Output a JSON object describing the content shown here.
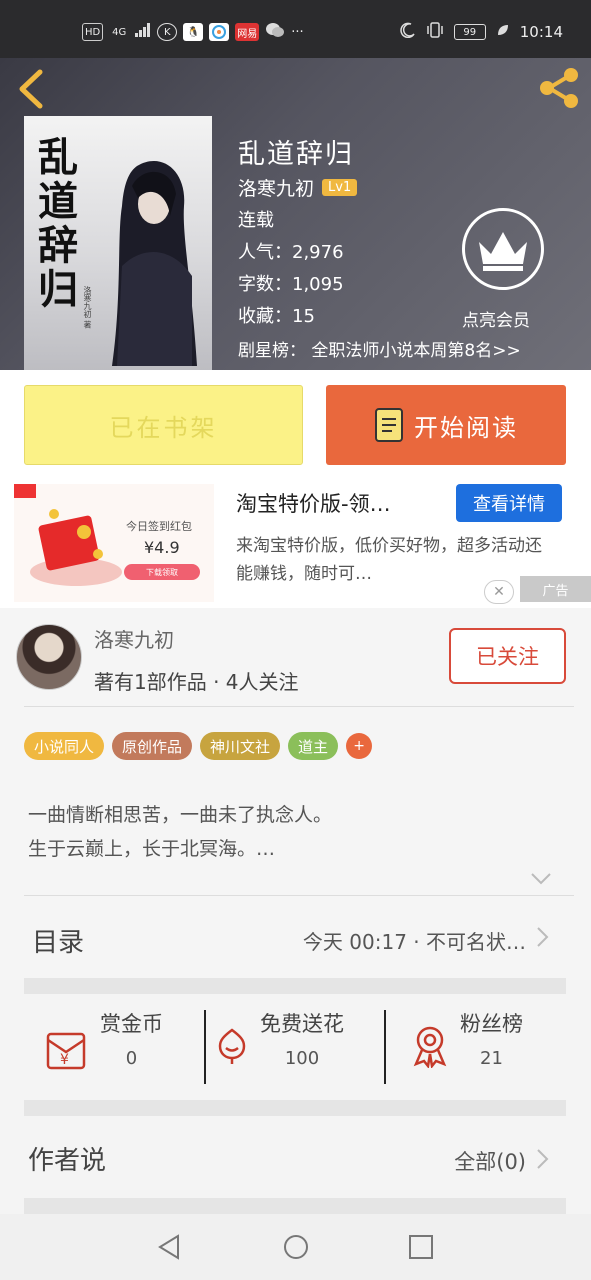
{
  "status_bar": {
    "left_icons": [
      "HD",
      "4G",
      "K",
      "QQ",
      "app",
      "网易",
      "wechat",
      "···"
    ],
    "time": "10:14",
    "battery": "99"
  },
  "book": {
    "title": "乱道辞归",
    "author": "洛寒九初",
    "level": "Lv1",
    "status": "连载",
    "popularity_label": "人气：",
    "popularity": "2,976",
    "words_label": "字数：",
    "words": "1,095",
    "favorites_label": "收藏：",
    "favorites": "15",
    "rank_text": "剧星榜：  全职法师小说本周第8名>>",
    "member_label": "点亮会员",
    "cover_title": "乱道辞归",
    "cover_author": "洛寒九初 著"
  },
  "actions": {
    "shelf_label": "已在书架",
    "read_label": "开始阅读"
  },
  "ad": {
    "image_caption": "今日签到红包",
    "image_amount": "¥4.9",
    "image_button": "下载领取",
    "title": "淘宝特价版-领…",
    "cta": "查看详情",
    "description": "来淘宝特价版，低价买好物，超多活动还能赚钱，随时可…",
    "close": "✕",
    "label": "广告"
  },
  "author_card": {
    "name": "洛寒九初",
    "meta": "著有1部作品 · 4人关注",
    "follow_label": "已关注"
  },
  "tags": [
    {
      "label": "小说同人",
      "color": "#f0b840"
    },
    {
      "label": "原创作品",
      "color": "#c27a5c"
    },
    {
      "label": "神川文社",
      "color": "#c7a43f"
    },
    {
      "label": "道主",
      "color": "#8bbf5a"
    }
  ],
  "tag_more": "+",
  "intro": {
    "line1": "一曲情断相思苦，一曲未了执念人。",
    "line2": "生于云巅上，长于北冥海。…"
  },
  "catalog": {
    "label": "目录",
    "update": "今天 00:17 · 不可名状…"
  },
  "stats": {
    "coins_label": "赏金币",
    "coins": "0",
    "flowers_label": "免费送花",
    "flowers": "100",
    "fans_label": "粉丝榜",
    "fans": "21"
  },
  "author_says": {
    "label": "作者说",
    "all": "全部(0)"
  },
  "colors": {
    "accent_orange": "#e9683d",
    "shelf_yellow": "#fbf287",
    "follow_red": "#d84a3a",
    "badge_gold": "#f0b840",
    "ad_blue": "#1e6fde"
  }
}
